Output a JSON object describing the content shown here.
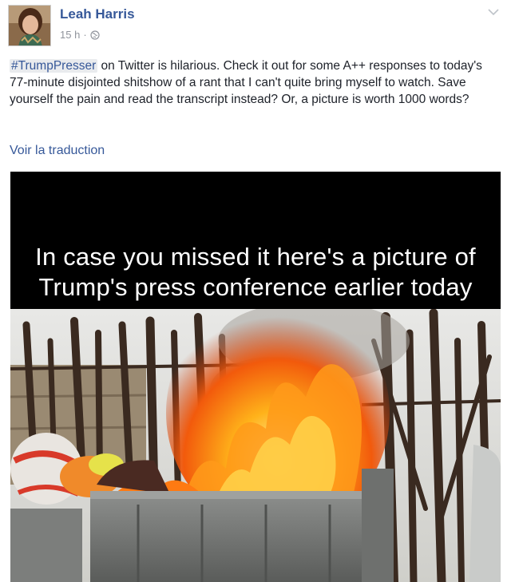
{
  "post": {
    "author": "Leah Harris",
    "time": "15 h",
    "separator": "·",
    "hashtag": "#TrumpPresser",
    "body": " on Twitter is hilarious. Check it out for some A++ responses to today's 77-minute disjointed shitshow of a rant that I can't quite bring myself to watch. Save yourself the pain and read the transcript instead? Or, a picture is worth 1000 words?",
    "translate_link": "Voir la traduction"
  },
  "image": {
    "caption_line1": "In case you missed it here's a picture of",
    "caption_line2": "Trump's press conference earlier today"
  },
  "icons": {
    "privacy": "globe-icon",
    "menu": "chevron-down-icon"
  },
  "colors": {
    "link": "#365899",
    "meta": "#90949c",
    "hashtag_bg": "#e9ebee"
  }
}
